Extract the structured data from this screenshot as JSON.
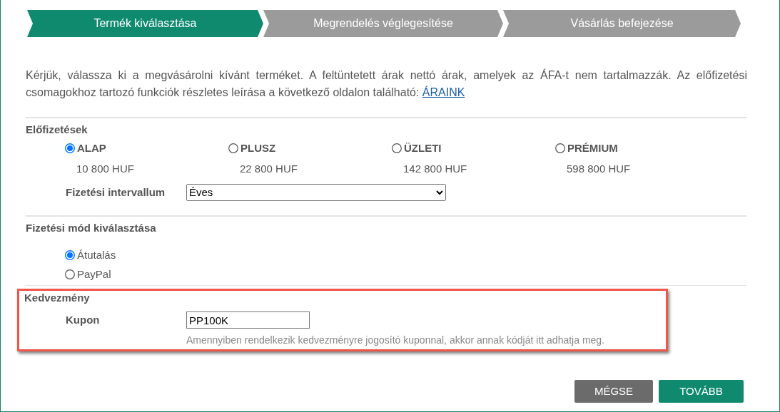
{
  "steps": [
    {
      "label": "Termék kiválasztása",
      "selected": true
    },
    {
      "label": "Megrendelés véglegesítése",
      "selected": false
    },
    {
      "label": "Vásárlás befejezése",
      "selected": false
    }
  ],
  "intro": {
    "text": "Kérjük, válassza ki a megvásárolni kívánt terméket. A feltüntetett árak nettó árak, amelyek az ÁFA-t nem tartalmazzák. Az előfizetési csomagokhoz tartozó funkciók részletes leírása a következő oldalon található:",
    "link": "ÁRAINK"
  },
  "subscriptions": {
    "title": "Előfizetések",
    "options": [
      {
        "name": "ALAP",
        "price": "10 800 HUF",
        "selected": true
      },
      {
        "name": "PLUSZ",
        "price": "22 800 HUF",
        "selected": false
      },
      {
        "name": "ÜZLETI",
        "price": "142 800 HUF",
        "selected": false
      },
      {
        "name": "PRÉMIUM",
        "price": "598 800 HUF",
        "selected": false
      }
    ],
    "interval_label": "Fizetési intervallum",
    "interval_value": "Éves"
  },
  "payment": {
    "title": "Fizetési mód kiválasztása",
    "options": [
      {
        "label": "Átutalás",
        "selected": true
      },
      {
        "label": "PayPal",
        "selected": false
      }
    ]
  },
  "discount": {
    "title": "Kedvezmény",
    "coupon_label": "Kupon",
    "coupon_value": "PP100K",
    "hint": "Amennyiben rendelkezik kedvezményre jogosító kuponnal, akkor annak kódját itt adhatja meg.",
    "highlighted": true
  },
  "buttons": [
    {
      "label": "MÉGSE",
      "kind": "secondary"
    },
    {
      "label": "TOVÁBB",
      "kind": "primary"
    }
  ]
}
